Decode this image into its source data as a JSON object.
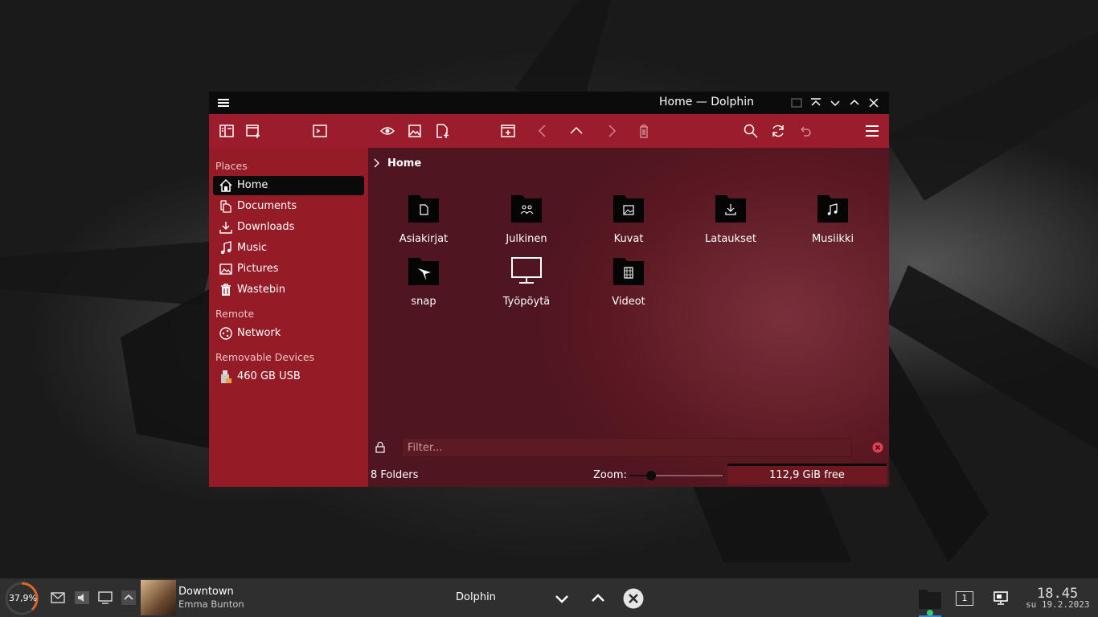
{
  "colors": {
    "window_accent": "#9b1c2a",
    "sidebar": "#951b26",
    "titlebar": "#0b0b0b",
    "taskbar": "#2f2f2f"
  },
  "window": {
    "title": "Home — Dolphin",
    "toolbar_icons": [
      "split-view-icon",
      "new-window-icon",
      "terminal-icon",
      "preview-icon",
      "image-icon",
      "new-tab-icon",
      "view-mode-icon",
      "back-icon",
      "up-icon",
      "forward-icon",
      "delete-icon",
      "search-icon",
      "reload-icon",
      "undo-icon",
      "hamburger-menu-icon"
    ]
  },
  "sidebar": {
    "places_heading": "Places",
    "places": [
      {
        "label": "Home",
        "icon": "home-icon",
        "active": true
      },
      {
        "label": "Documents",
        "icon": "documents-icon"
      },
      {
        "label": "Downloads",
        "icon": "downloads-icon"
      },
      {
        "label": "Music",
        "icon": "music-icon"
      },
      {
        "label": "Pictures",
        "icon": "pictures-icon"
      },
      {
        "label": "Wastebin",
        "icon": "trash-icon"
      }
    ],
    "remote_heading": "Remote",
    "remote": [
      {
        "label": "Network",
        "icon": "network-icon"
      }
    ],
    "removable_heading": "Removable Devices",
    "removable": [
      {
        "label": "460 GB USB",
        "icon": "usb-drive-icon"
      }
    ]
  },
  "main": {
    "breadcrumb": "Home",
    "items": [
      {
        "name": "Asiakirjat",
        "icon": "folder-documents-icon"
      },
      {
        "name": "Julkinen",
        "icon": "folder-public-icon"
      },
      {
        "name": "Kuvat",
        "icon": "folder-pictures-icon"
      },
      {
        "name": "Lataukset",
        "icon": "folder-downloads-icon"
      },
      {
        "name": "Musiikki",
        "icon": "folder-music-icon"
      },
      {
        "name": "snap",
        "icon": "folder-snap-icon"
      },
      {
        "name": "Työpöytä",
        "icon": "desktop-icon"
      },
      {
        "name": "Videot",
        "icon": "folder-videos-icon"
      }
    ],
    "filter_placeholder": "Filter...",
    "status_count": "8 Folders",
    "zoom_label": "Zoom:",
    "zoom_level": 0.23,
    "free_space": "112,9 GiB free"
  },
  "taskbar": {
    "battery": "37,9%",
    "battery_level": 0.379,
    "media_title": "Downtown",
    "media_artist": "Emma Bunton",
    "active_task": "Dolphin",
    "pager_number": "1",
    "clock_time": "18.45",
    "clock_date": "su 19.2.2023"
  }
}
